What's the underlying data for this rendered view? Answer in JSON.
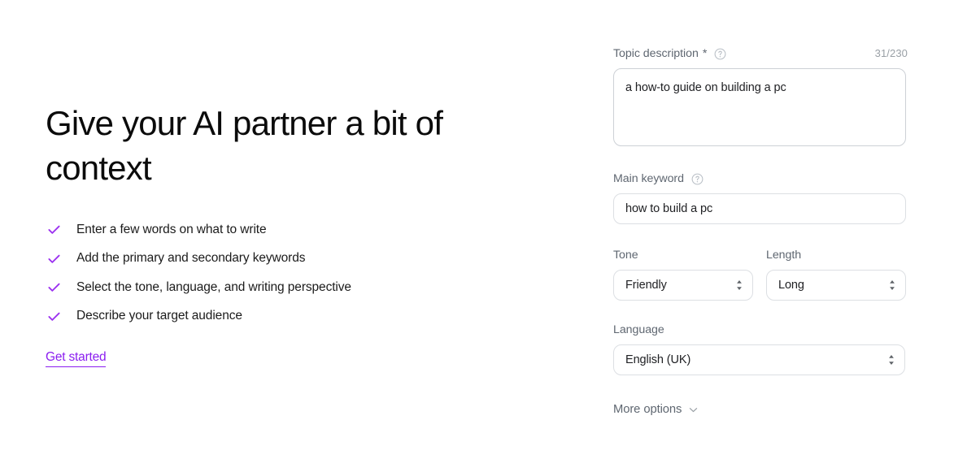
{
  "hero": {
    "title": "Give your AI partner a bit of context",
    "benefits": [
      {
        "icon": "check-icon",
        "text": "Enter a few words on what to write"
      },
      {
        "icon": "check-icon",
        "text": "Add the primary and secondary keywords"
      },
      {
        "icon": "check-icon",
        "text": "Select the tone, language, and writing perspective"
      },
      {
        "icon": "check-icon",
        "text": "Describe your target audience"
      }
    ],
    "cta_label": "Get started"
  },
  "form": {
    "topic_description": {
      "label": "Topic description",
      "required_marker": "*",
      "help_icon": "help-circle-icon",
      "counter": "31/230",
      "value": "a how-to guide on building a pc",
      "placeholder": ""
    },
    "main_keyword": {
      "label": "Main keyword",
      "help_icon": "help-circle-icon",
      "value": "how to build a pc",
      "placeholder": ""
    },
    "tone": {
      "label": "Tone",
      "value": "Friendly",
      "options": [
        "Friendly"
      ],
      "icon": "chevron-updown-icon"
    },
    "length": {
      "label": "Length",
      "value": "Long",
      "options": [
        "Long"
      ],
      "icon": "chevron-updown-icon"
    },
    "language": {
      "label": "Language",
      "value": "English (UK)",
      "options": [
        "English (UK)"
      ],
      "icon": "chevron-updown-icon"
    },
    "more_options": {
      "label": "More options",
      "icon": "chevron-down-icon"
    }
  },
  "colors": {
    "accent": "#8b1ef0",
    "check": "#9b30f0",
    "label_text": "#5f6771",
    "body_text": "#202124",
    "border": "#dcdfe3",
    "textarea_border": "#cdd1d6",
    "muted": "#9aa0a6"
  }
}
